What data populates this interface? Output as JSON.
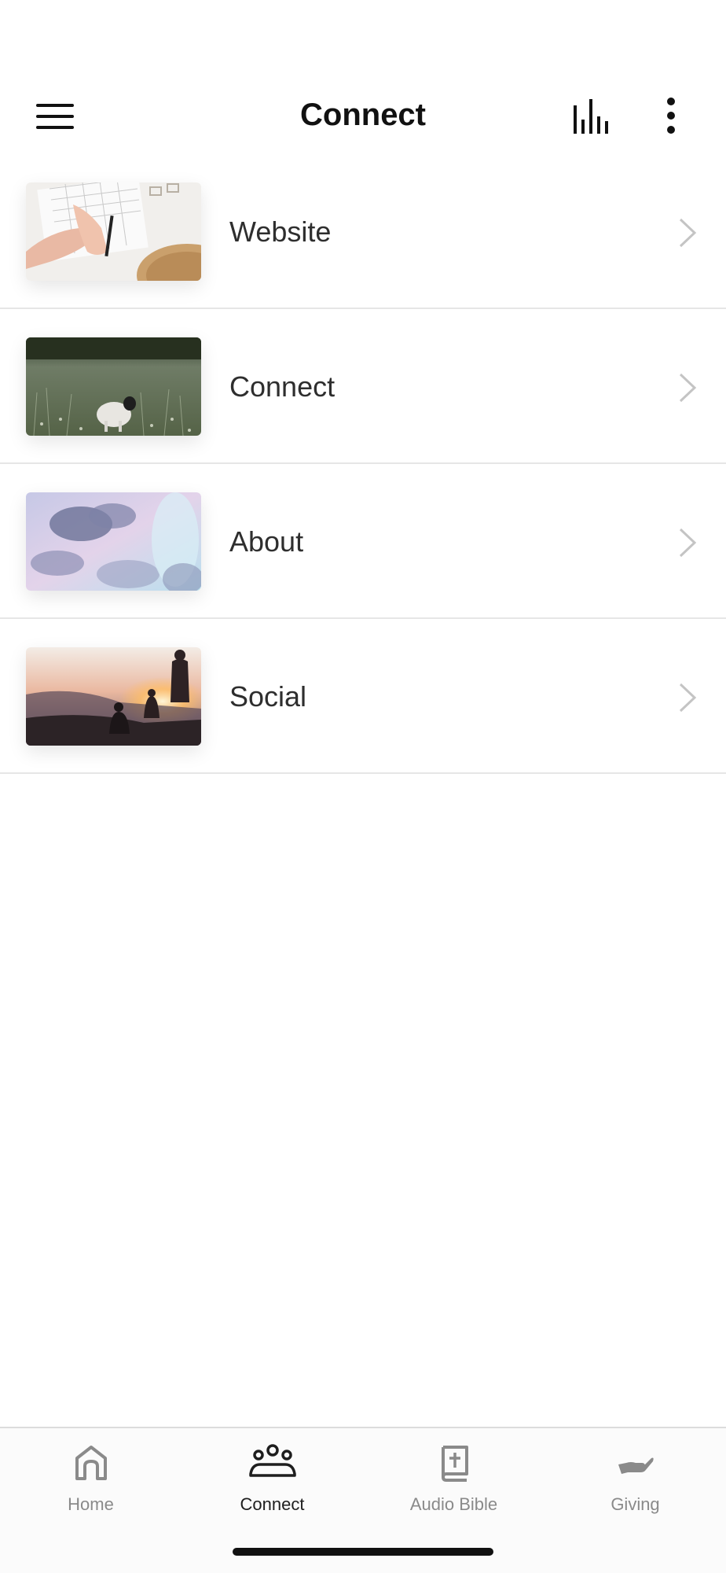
{
  "header": {
    "title": "Connect",
    "menu_icon": "hamburger-menu-icon",
    "audio_icon": "audio-bars-icon",
    "more_icon": "more-vertical-icon"
  },
  "list": {
    "items": [
      {
        "label": "Website",
        "thumbnail": "planner-hands-photo"
      },
      {
        "label": "Connect",
        "thumbnail": "meadow-lamb-photo"
      },
      {
        "label": "About",
        "thumbnail": "clouds-sky-photo"
      },
      {
        "label": "Social",
        "thumbnail": "sunset-people-photo"
      }
    ],
    "chevron_icon": "chevron-right-icon"
  },
  "tabs": {
    "items": [
      {
        "label": "Home",
        "icon": "home-icon",
        "active": false
      },
      {
        "label": "Connect",
        "icon": "group-icon",
        "active": true
      },
      {
        "label": "Audio Bible",
        "icon": "bible-icon",
        "active": false
      },
      {
        "label": "Giving",
        "icon": "giving-hand-icon",
        "active": false
      }
    ]
  },
  "colors": {
    "active_tab": "#1e1e1e",
    "inactive_tab": "#8a8a8a",
    "divider": "#e6e6e6"
  }
}
